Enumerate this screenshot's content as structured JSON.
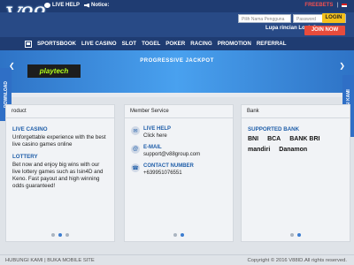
{
  "header": {
    "logo_text": "V88",
    "live_help": "LIVE HELP",
    "notice": "Notice:",
    "freebets": "FREEBETS",
    "separator": "|"
  },
  "login": {
    "username_placeholder": "Pilih Nama Pengguna",
    "password_placeholder": "Password",
    "login_label": "LOGIN",
    "forgot_label": "Lupa rincian Login?",
    "join_label": "JOIN NOW"
  },
  "nav": {
    "items": [
      "SPORTSBOOK",
      "LIVE CASINO",
      "SLOT",
      "TOGEL",
      "POKER",
      "RACING",
      "PROMOTION",
      "REFERRAL"
    ]
  },
  "banner": {
    "headline": "PROGRESSIVE JACKPOT",
    "brand": "playtech"
  },
  "side_tabs": {
    "download": "DOWNLOAD",
    "hubungi": "HUBUNGI KAMI"
  },
  "panels": {
    "product": {
      "title": "roduct",
      "sections": [
        {
          "title": "LIVE CASINO",
          "text": "Unforgettable experience with the best live casino games online"
        },
        {
          "title": "LOTTERY",
          "text": "Bet now and enjoy big wins with our live lottery games such as Isin4D and Keno. Fast payout and high winning odds guaranteed!"
        }
      ]
    },
    "service": {
      "title": "Member Service",
      "items": [
        {
          "title": "LIVE HELP",
          "value": "Click here"
        },
        {
          "title": "E-MAIL",
          "value": "support@v88group.com"
        },
        {
          "title": "CONTACT NUMBER",
          "value": "+639951076551"
        }
      ]
    },
    "bank": {
      "title": "Bank",
      "supported": "SUPPORTED BANK",
      "banks": [
        "BNI",
        "BCA",
        "BANK BRI",
        "mandiri",
        "Danamon"
      ]
    }
  },
  "footer": {
    "left": "HUBUNGI KAMI | BUKA MOBILE SITE",
    "right": "Copyright © 2016 V88ID.All rights reserved."
  },
  "colors": {
    "header_bg": "#1f3c72",
    "banner_bg": "#49a1ef",
    "accent": "#1f5ea9",
    "login_button": "#f5c11b",
    "join_button": "#e74c3c"
  }
}
